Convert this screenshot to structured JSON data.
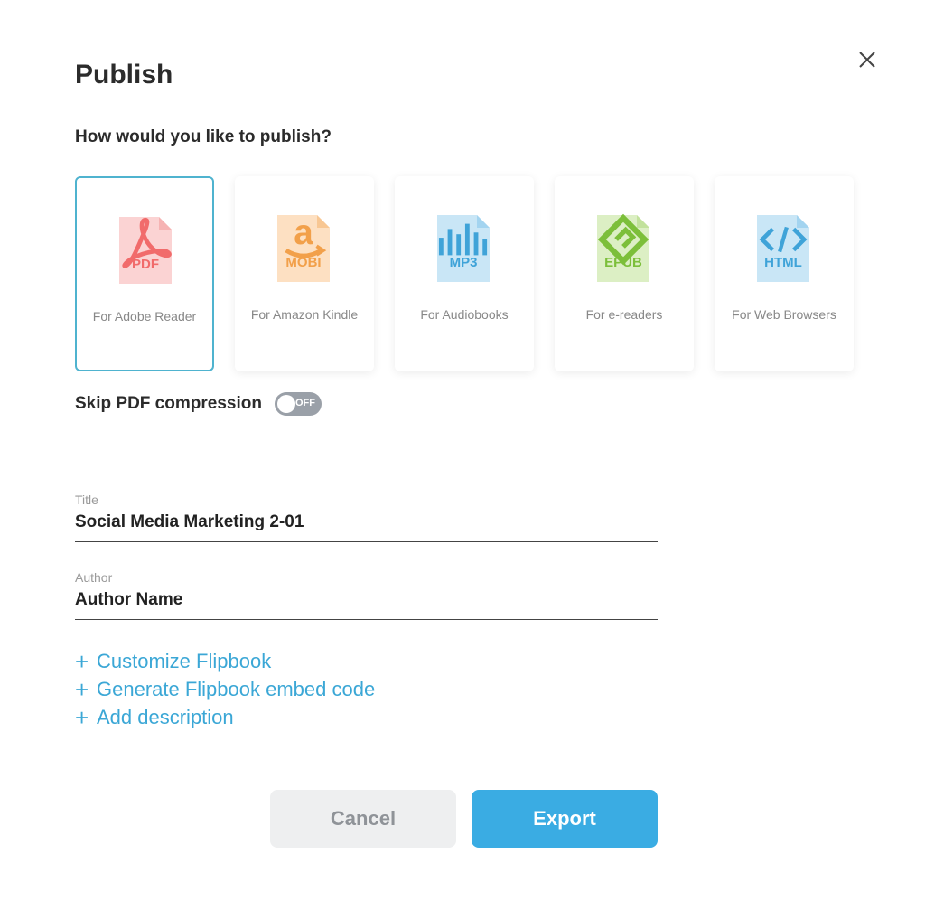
{
  "dialog": {
    "title": "Publish",
    "question": "How would you like to publish?"
  },
  "formats": [
    {
      "label": "PDF",
      "desc": "For Adobe Reader",
      "color": "#f16b6b",
      "bg": "#fbd3d3",
      "icon": "pdf-icon",
      "selected": true
    },
    {
      "label": "MOBI",
      "desc": "For Amazon Kindle",
      "color": "#f2a04a",
      "bg": "#fde0c2",
      "icon": "amazon-icon",
      "selected": false
    },
    {
      "label": "MP3",
      "desc": "For Audiobooks",
      "color": "#3fa3d8",
      "bg": "#c9e6f6",
      "icon": "audio-bars-icon",
      "selected": false
    },
    {
      "label": "EPUB",
      "desc": "For e-readers",
      "color": "#7cbf3a",
      "bg": "#dcefc4",
      "icon": "epub-icon",
      "selected": false
    },
    {
      "label": "HTML",
      "desc": "For Web Browsers",
      "color": "#3fa3d8",
      "bg": "#c9e6f6",
      "icon": "code-icon",
      "selected": false
    }
  ],
  "compression": {
    "label": "Skip PDF compression",
    "state": "OFF"
  },
  "fields": {
    "title_label": "Title",
    "title_value": "Social Media Marketing 2-01",
    "author_label": "Author",
    "author_value": "Author Name"
  },
  "links": {
    "customize": "Customize Flipbook",
    "embed": "Generate Flipbook embed code",
    "description": "Add description"
  },
  "buttons": {
    "cancel": "Cancel",
    "export": "Export"
  }
}
